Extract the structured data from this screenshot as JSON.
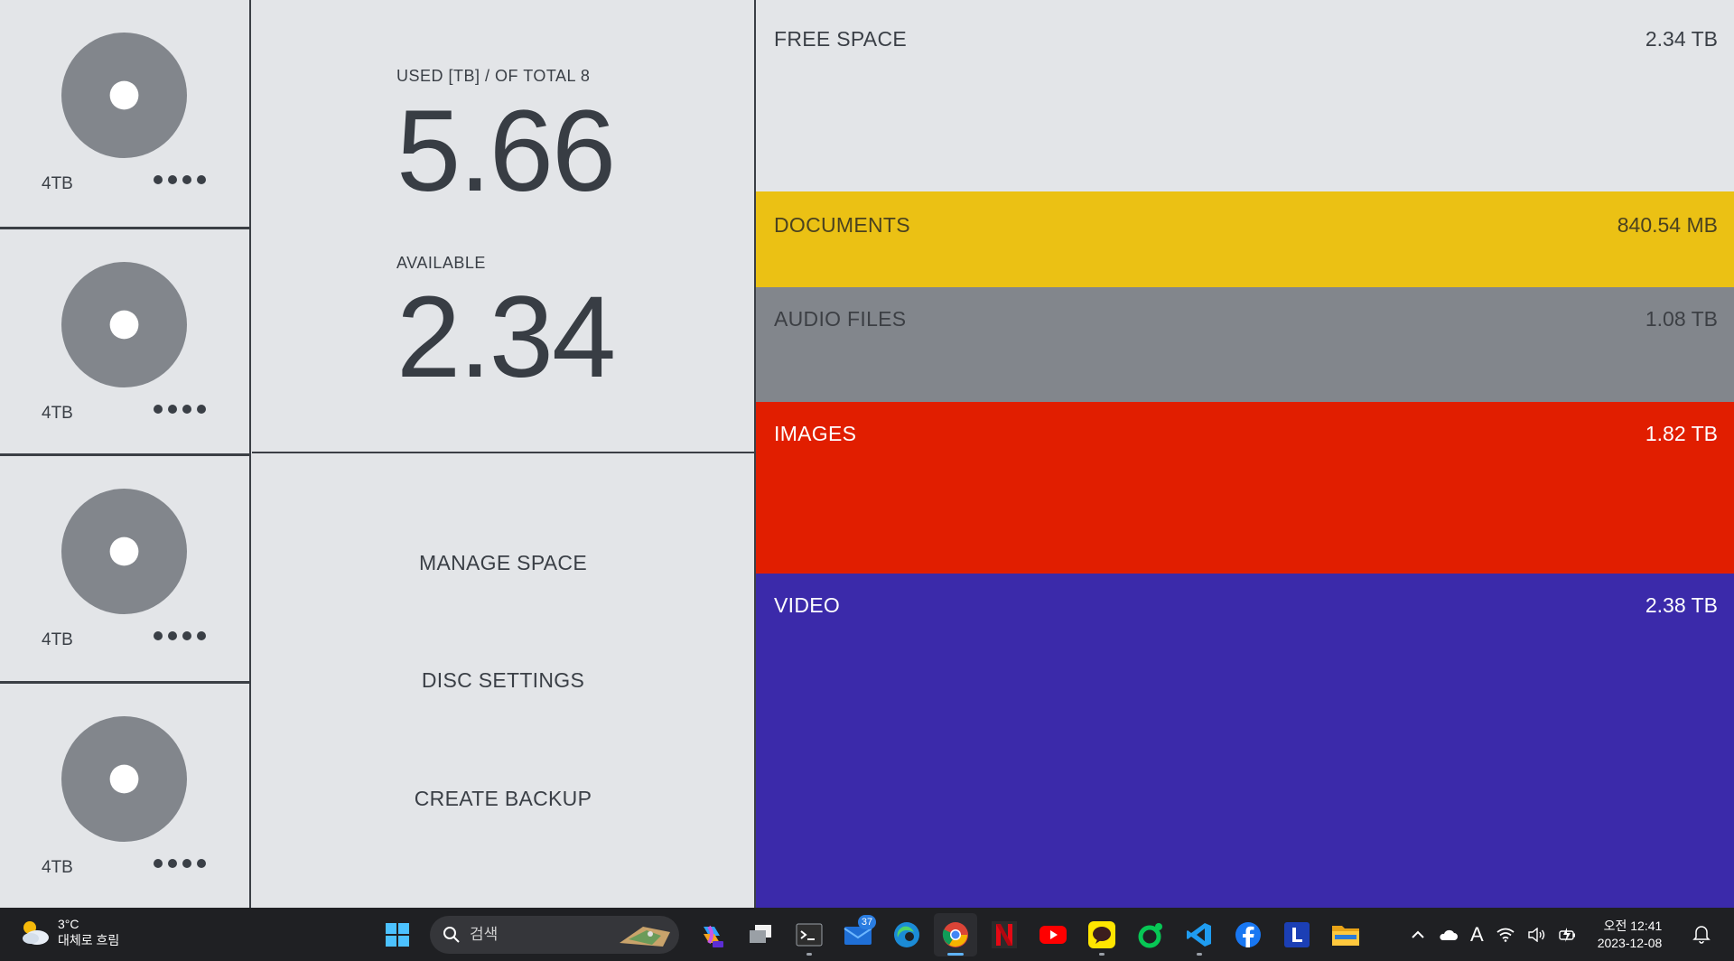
{
  "discs": [
    {
      "size": "4TB"
    },
    {
      "size": "4TB"
    },
    {
      "size": "4TB"
    },
    {
      "size": "4TB"
    }
  ],
  "stats": {
    "used_label": "USED [TB] / OF TOTAL 8",
    "used_value": "5.66",
    "available_label": "AVAILABLE",
    "available_value": "2.34"
  },
  "actions": {
    "manage": "MANAGE SPACE",
    "disc_settings": "DISC SETTINGS",
    "backup": "CREATE BACKUP"
  },
  "storage": {
    "free": {
      "label": "FREE SPACE",
      "value": "2.34 TB",
      "color": "#e3e5e8"
    },
    "documents": {
      "label": "DOCUMENTS",
      "value": "840.54 MB",
      "color": "#ebc114"
    },
    "audio": {
      "label": "AUDIO FILES",
      "value": "1.08 TB",
      "color": "#82868c"
    },
    "images": {
      "label": "IMAGES",
      "value": "1.82 TB",
      "color": "#e11e00"
    },
    "video": {
      "label": "VIDEO",
      "value": "2.38 TB",
      "color": "#3b2aaa"
    }
  },
  "taskbar": {
    "weather_temp": "3°C",
    "weather_desc": "대체로 흐림",
    "search_placeholder": "검색",
    "mail_badge": "37",
    "tray_ime": "A",
    "clock_time": "오전 12:41",
    "clock_date": "2023-12-08",
    "icons": [
      "windows-start",
      "copilot",
      "task-view",
      "terminal",
      "mail",
      "edge",
      "chrome",
      "netflix",
      "youtube",
      "kakaotalk",
      "naver-line",
      "vscode",
      "facebook",
      "l-app",
      "file-explorer"
    ]
  }
}
